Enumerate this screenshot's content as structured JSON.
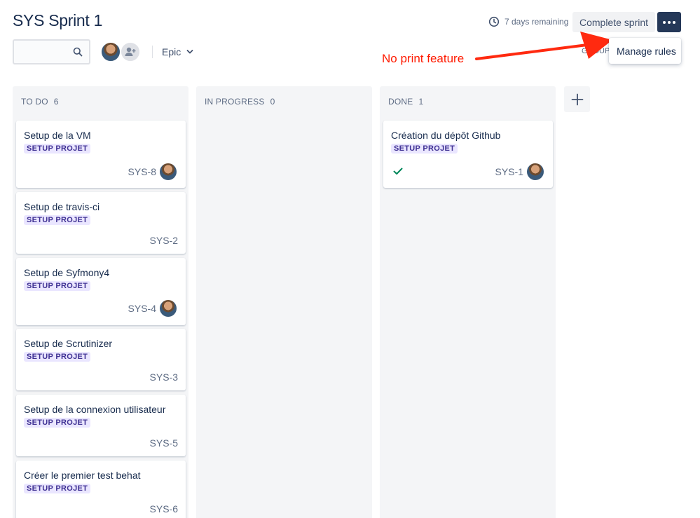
{
  "header": {
    "title": "SYS Sprint 1",
    "remaining": "7 days remaining",
    "complete_label": "Complete sprint",
    "group_by_partial": "GROUP B"
  },
  "filters": {
    "search_placeholder": "",
    "epic_label": "Epic"
  },
  "menu": {
    "manage_rules": "Manage rules"
  },
  "annotation": {
    "text": "No print feature",
    "color": "#ff1a00"
  },
  "columns": [
    {
      "name": "TO DO",
      "count": "6",
      "cards": [
        {
          "title": "Setup de la VM",
          "epic": "SETUP PROJET",
          "key": "SYS-8",
          "has_avatar": true
        },
        {
          "title": "Setup de travis-ci",
          "epic": "SETUP PROJET",
          "key": "SYS-2",
          "has_avatar": false
        },
        {
          "title": "Setup de Syfmony4",
          "epic": "SETUP PROJET",
          "key": "SYS-4",
          "has_avatar": true
        },
        {
          "title": "Setup de Scrutinizer",
          "epic": "SETUP PROJET",
          "key": "SYS-3",
          "has_avatar": false
        },
        {
          "title": "Setup de la connexion utilisateur",
          "epic": "SETUP PROJET",
          "key": "SYS-5",
          "has_avatar": false
        },
        {
          "title": "Créer le premier test behat",
          "epic": "SETUP PROJET",
          "key": "SYS-6",
          "has_avatar": false
        }
      ]
    },
    {
      "name": "IN PROGRESS",
      "count": "0",
      "cards": []
    },
    {
      "name": "DONE",
      "count": "1",
      "cards": [
        {
          "title": "Création du dépôt Github",
          "epic": "SETUP PROJET",
          "key": "SYS-1",
          "has_avatar": true,
          "done": true
        }
      ]
    }
  ],
  "colors": {
    "epic_bg": "#eae6ff",
    "epic_text": "#403294",
    "done_check": "#00875a",
    "more_button": "#253858"
  }
}
